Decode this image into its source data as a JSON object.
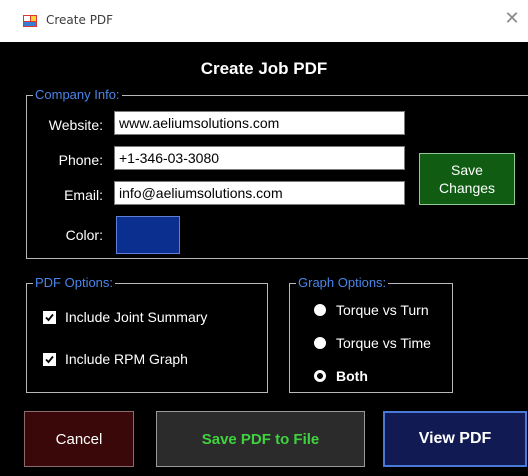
{
  "window": {
    "title": "Create PDF",
    "icon": "form-app-icon",
    "close_glyph": "✕"
  },
  "header": {
    "title": "Create Job PDF"
  },
  "company_info": {
    "legend": "Company Info:",
    "website": {
      "label": "Website:",
      "value": "www.aeliumsolutions.com"
    },
    "phone": {
      "label": "Phone:",
      "value": "+1-346-03-3080"
    },
    "email": {
      "label": "Email:",
      "value": "info@aeliumsolutions.com"
    },
    "color": {
      "label": "Color:",
      "value": "#0a2f8f"
    },
    "save_changes": {
      "line1": "Save",
      "line2": "Changes"
    }
  },
  "pdf_options": {
    "legend": "PDF Options:",
    "items": [
      {
        "label": "Include Joint Summary",
        "checked": true
      },
      {
        "label": "Include RPM Graph",
        "checked": true
      }
    ]
  },
  "graph_options": {
    "legend": "Graph Options:",
    "items": [
      {
        "label": "Torque vs Turn",
        "selected": false
      },
      {
        "label": "Torque vs Time",
        "selected": false
      },
      {
        "label": "Both",
        "selected": true
      }
    ]
  },
  "buttons": {
    "cancel": "Cancel",
    "save_pdf": "Save PDF to File",
    "view_pdf": "View PDF"
  },
  "colors": {
    "background": "#000000",
    "legend_text": "#4a86e8",
    "company_color": "#0a2f8f",
    "save_changes_bg": "#0f5c12",
    "cancel_bg": "#3a0808",
    "save_pdf_bg": "#2b2b2b",
    "save_pdf_text": "#3fd23f",
    "view_pdf_bg": "#121a54"
  }
}
